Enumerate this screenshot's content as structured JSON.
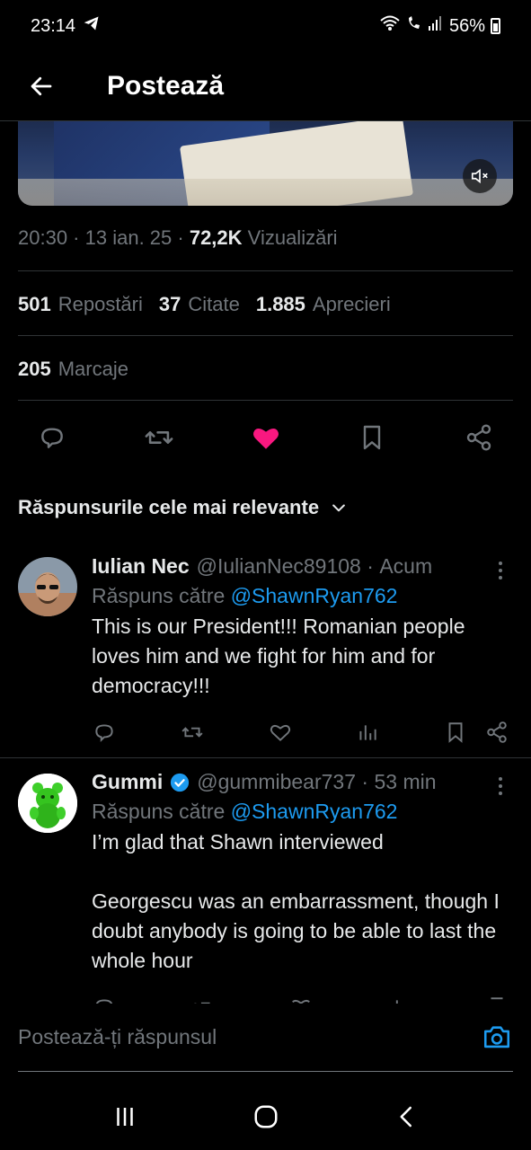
{
  "status_bar": {
    "time": "23:14",
    "battery": "56%"
  },
  "header": {
    "title": "Postează"
  },
  "post": {
    "time": "20:30",
    "date": "13 ian. 25",
    "views_count": "72,2K",
    "views_label": "Vizualizări",
    "reposts_count": "501",
    "reposts_label": "Repostări",
    "quotes_count": "37",
    "quotes_label": "Citate",
    "likes_count": "1.885",
    "likes_label": "Aprecieri",
    "bookmarks_count": "205",
    "bookmarks_label": "Marcaje"
  },
  "replies_sort": {
    "label": "Răspunsurile cele mai relevante"
  },
  "replies": [
    {
      "name": "Iulian Nec",
      "handle": "@IulianNec89108",
      "time": "Acum",
      "reply_to_prefix": "Răspuns către",
      "reply_to_handle": "@ShawnRyan762",
      "text": "This is our President!!! Romanian people loves him and we fight for him and for democracy!!!"
    },
    {
      "name": "Gummi",
      "handle": "@gummibear737",
      "time": "53 min",
      "reply_to_prefix": "Răspuns către",
      "reply_to_handle": "@ShawnRyan762",
      "text": "I’m glad that Shawn interviewed\n\nGeorgescu was an embarrassment, though I doubt anybody is going to be able to last the whole hour"
    }
  ],
  "composer": {
    "placeholder": "Postează-ți răspunsul"
  },
  "colors": {
    "background": "#000000",
    "text": "#e7e9ea",
    "muted": "#71767b",
    "accent": "#1d9bf0",
    "like": "#f91880",
    "divider": "#2f3336"
  }
}
